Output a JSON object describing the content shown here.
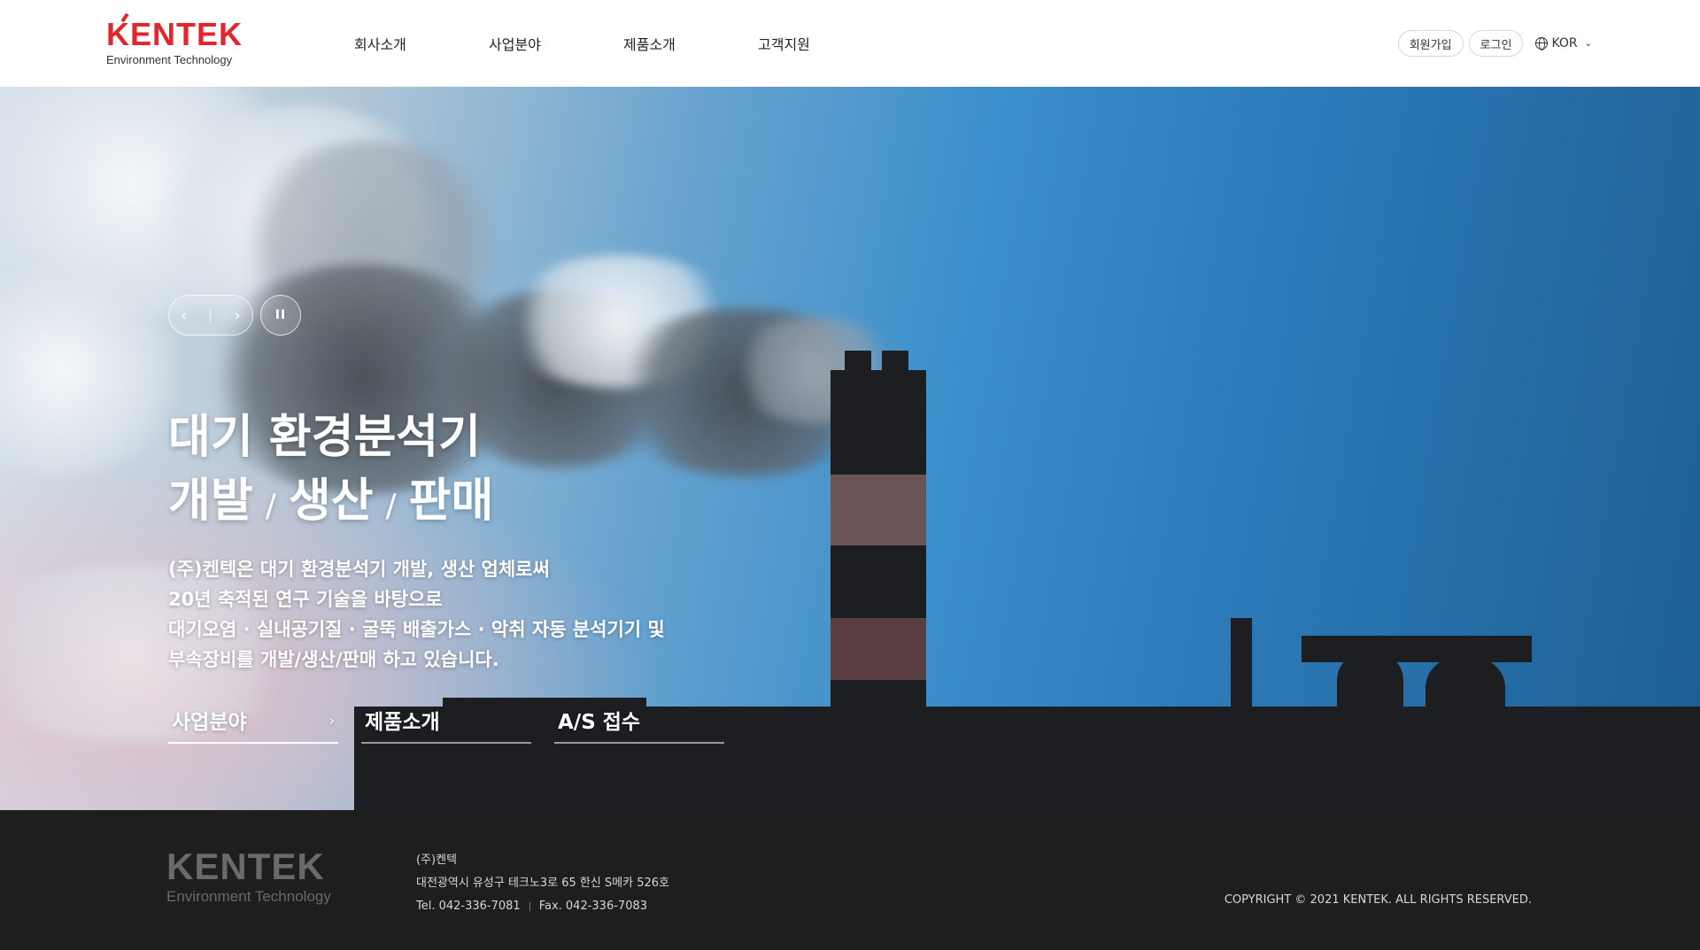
{
  "header": {
    "logo_text": "KENTEK",
    "logo_sub": "Environment Technology",
    "nav": [
      "회사소개",
      "사업분야",
      "제품소개",
      "고객지원"
    ],
    "signup_label": "회원가입",
    "login_label": "로그인",
    "language": "KOR"
  },
  "hero": {
    "headline_line1": "대기 환경분석기",
    "headline_line2": [
      "개발",
      "생산",
      "판매"
    ],
    "headline_sep": "/",
    "description": [
      "(주)켄텍은 대기 환경분석기 개발, 생산 업체로써",
      "20년 축적된 연구 기술을 바탕으로",
      "대기오염 · 실내공기질 · 굴뚝 배출가스 · 악취 자동 분석기기 및",
      "부속장비를 개발/생산/판매 하고 있습니다."
    ],
    "quick_links": [
      "사업분야",
      "제품소개",
      "A/S 접수"
    ],
    "prev_glyph": "‹",
    "next_glyph": "›",
    "pause_glyph": "II"
  },
  "footer": {
    "logo_text": "KENTEK",
    "logo_sub": "Environment Technology",
    "company": "(주)켄텍",
    "address": "대전광역시 유성구 테크노3로 65 한신 S메카 526호",
    "tel": "Tel. 042-336-7081",
    "fax": "Fax. 042-336-7083",
    "copyright": "COPYRIGHT © 2021 KENTEK. ALL RIGHTS RESERVED."
  },
  "colors": {
    "brand_red": "#e1262d",
    "footer_bg": "#1e1e1e"
  }
}
